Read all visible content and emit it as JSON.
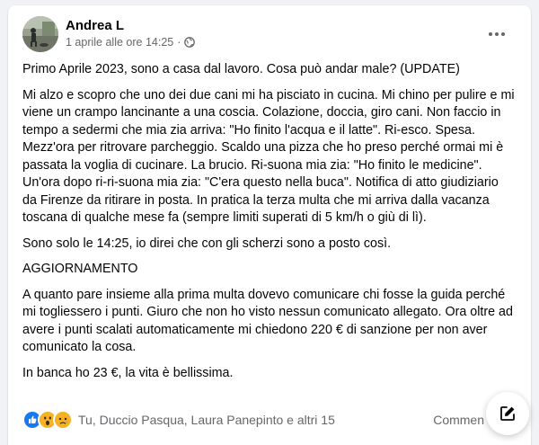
{
  "post": {
    "author": "Andrea L",
    "timestamp": "1 aprile alle ore 14:25",
    "separator": "·",
    "privacy_icon": "globe-icon",
    "more_icon": "more-horizontal-icon",
    "paragraphs": [
      "Primo Aprile 2023, sono a casa dal lavoro. Cosa può andar male? (UPDATE)",
      "Mi alzo e scopro che uno dei due cani mi ha pisciato in cucina. Mi chino per pulire e mi viene un crampo lancinante a una coscia. Colazione, doccia, giro cani. Non faccio in tempo a sedermi che mia zia arriva: \"Ho finito l'acqua e il latte\". Ri-esco. Spesa. Mezz'ora per ritrovare parcheggio. Scaldo una pizza che ho preso perché ormai mi è passata la voglia di cucinare. La brucio. Ri-suona mia zia: \"Ho finito le medicine\". Un'ora dopo ri-ri-suona mia zia: \"C'era questo nella buca\". Notifica di atto giudiziario da Firenze da ritirare in posta. In pratica la terza multa che mi arriva dalla vacanza toscana di qualche mese fa (sempre limiti superati di 5 km/h o giù di lì).",
      "Sono solo le 14:25, io direi che con gli scherzi sono a posto così.",
      "AGGIORNAMENTO",
      "A quanto pare insieme alla prima multa dovevo comunicare chi fosse la guida perché mi toglies­sero i punti. Giuro che non ho visto nessun comunicato allegato. Ora oltre ad avere i punti scalati automaticamente mi chiedono 220 € di sanzione per non aver comunicato la cosa.",
      "In banca ho 23 €, la vita è bellissima."
    ]
  },
  "footer": {
    "reaction_icons": [
      "like-icon",
      "wow-icon",
      "sad-icon"
    ],
    "reactions_text": "Tu, Duccio Pasqua, Laura Panepinto e altri 15",
    "comments_text": "Commen"
  },
  "fab": {
    "icon": "compose-icon"
  },
  "colors": {
    "like": "#1877f2",
    "wow": "#f7b125",
    "secondary_text": "#65676b",
    "background": "#f0f2f5"
  }
}
